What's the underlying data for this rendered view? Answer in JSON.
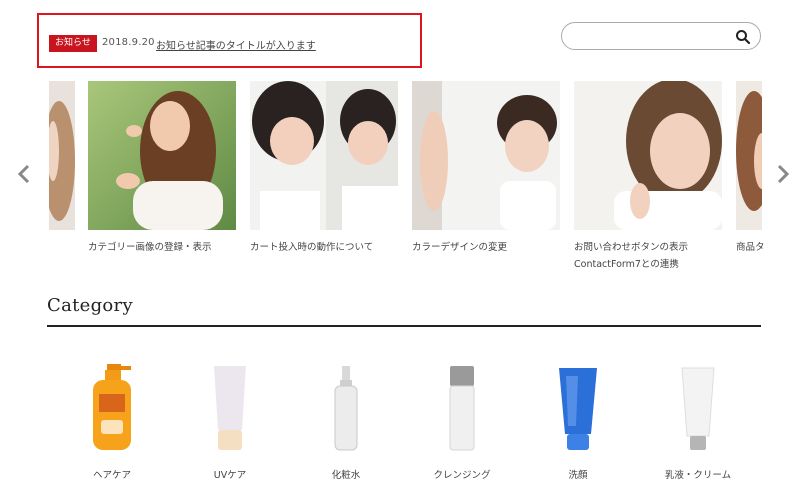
{
  "news": {
    "badge": "お知らせ",
    "date": "2018.9.20",
    "title": "お知らせ記事のタイトルが入ります"
  },
  "search": {
    "placeholder": "",
    "icon": "search-icon"
  },
  "slider": {
    "prev_icon": "chevron-left-icon",
    "next_icon": "chevron-right-icon",
    "slides": [
      {
        "caption": ""
      },
      {
        "caption": "カテゴリー画像の登録・表示"
      },
      {
        "caption": "カート投入時の動作について"
      },
      {
        "caption": "カラーデザインの変更"
      },
      {
        "caption": "お問い合わせボタンの表示 ContactForm7との連携"
      },
      {
        "caption": "商品タ"
      }
    ]
  },
  "category": {
    "title": "Category",
    "items": [
      {
        "label": "ヘアケア"
      },
      {
        "label": "UVケア"
      },
      {
        "label": "化粧水"
      },
      {
        "label": "クレンジング"
      },
      {
        "label": "洗顔"
      },
      {
        "label": "乳液・クリーム"
      }
    ]
  },
  "colors": {
    "accent": "#c8141e",
    "highlight_border": "#e0141e"
  }
}
